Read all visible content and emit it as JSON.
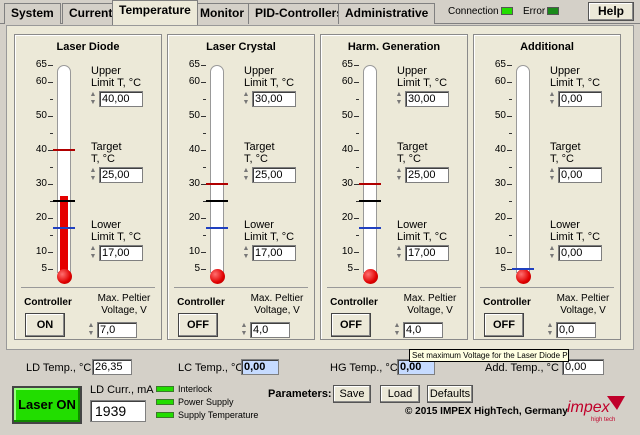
{
  "tabs": [
    {
      "label": "System"
    },
    {
      "label": "Current"
    },
    {
      "label": "Temperature",
      "active": true
    },
    {
      "label": "Monitor"
    },
    {
      "label": "PID-Controllers"
    },
    {
      "label": "Administrative"
    }
  ],
  "header": {
    "connection_label": "Connection",
    "error_label": "Error",
    "help_label": "Help",
    "connection_color": "#22dd00",
    "error_color": "#1a8a1a"
  },
  "scale_ticks": [
    "65",
    "60",
    "50",
    "40",
    "30",
    "20",
    "10",
    "5"
  ],
  "panels": [
    {
      "title": "Laser Diode",
      "upper_label_1": "Upper",
      "upper_label_2": "Limit T, °C",
      "upper_value": "40,00",
      "target_label_1": "Target",
      "target_label_2": "T, °C",
      "target_value": "25,00",
      "lower_label_1": "Lower",
      "lower_label_2": "Limit T, °C",
      "lower_value": "17,00",
      "controller_label": "Controller",
      "controller_state": "ON",
      "peltier_label_1": "Max. Peltier",
      "peltier_label_2": "Voltage, V",
      "peltier_value": "7,0",
      "current_temp": 26.35,
      "upper_limit": 40,
      "target": 25,
      "lower_limit": 17
    },
    {
      "title": "Laser Crystal",
      "upper_label_1": "Upper",
      "upper_label_2": "Limit T, °C",
      "upper_value": "30,00",
      "target_label_1": "Target",
      "target_label_2": "T, °C",
      "target_value": "25,00",
      "lower_label_1": "Lower",
      "lower_label_2": "Limit T, °C",
      "lower_value": "17,00",
      "controller_label": "Controller",
      "controller_state": "OFF",
      "peltier_label_1": "Max. Peltier",
      "peltier_label_2": "Voltage, V",
      "peltier_value": "4,0",
      "current_temp": 0,
      "upper_limit": 30,
      "target": 25,
      "lower_limit": 17
    },
    {
      "title": "Harm. Generation",
      "upper_label_1": "Upper",
      "upper_label_2": "Limit T, °C",
      "upper_value": "30,00",
      "target_label_1": "Target",
      "target_label_2": "T, °C",
      "target_value": "25,00",
      "lower_label_1": "Lower",
      "lower_label_2": "Limit T, °C",
      "lower_value": "17,00",
      "controller_label": "Controller",
      "controller_state": "OFF",
      "peltier_label_1": "Max. Peltier",
      "peltier_label_2": "Voltage, V",
      "peltier_value": "4,0",
      "current_temp": 0,
      "upper_limit": 30,
      "target": 25,
      "lower_limit": 17
    },
    {
      "title": "Additional",
      "upper_label_1": "Upper",
      "upper_label_2": "Limit T, °C",
      "upper_value": "0,00",
      "target_label_1": "Target",
      "target_label_2": "T, °C",
      "target_value": "0,00",
      "lower_label_1": "Lower",
      "lower_label_2": "Limit T, °C",
      "lower_value": "0,00",
      "controller_label": "Controller",
      "controller_state": "OFF",
      "peltier_label_1": "Max. Peltier",
      "peltier_label_2": "Voltage, V",
      "peltier_value": "0,0",
      "current_temp": 0,
      "upper_limit": 0,
      "target": 0,
      "lower_limit": 0
    }
  ],
  "tooltip": "Set maximum Voltage for the Laser Diode Peltier (TEC).",
  "status": {
    "ld_temp_label": "LD Temp., °C",
    "ld_temp_value": "26,35",
    "lc_temp_label": "LC Temp., °C",
    "lc_temp_value": "0,00",
    "hg_temp_label": "HG Temp., °C",
    "hg_temp_value": "0,00",
    "add_temp_label": "Add. Temp., °C",
    "add_temp_value": "0,00",
    "laser_button": "Laser ON",
    "ld_curr_label": "LD Curr., mA",
    "ld_curr_value": "1939",
    "indicators": [
      "Interlock",
      "Power Supply",
      "Supply Temperature"
    ],
    "params_label": "Parameters:",
    "save_label": "Save",
    "load_label": "Load",
    "defaults_label": "Defaults",
    "copyright": "© 2015 IMPEX HighTech, Germany",
    "logo_text": "impex",
    "logo_sub": "high tech"
  },
  "colors": {
    "mercury": "#e50000",
    "upper_mark": "#b00000",
    "target_mark": "#000000",
    "lower_mark": "#2040c0",
    "laser_on": "#22dd00"
  }
}
